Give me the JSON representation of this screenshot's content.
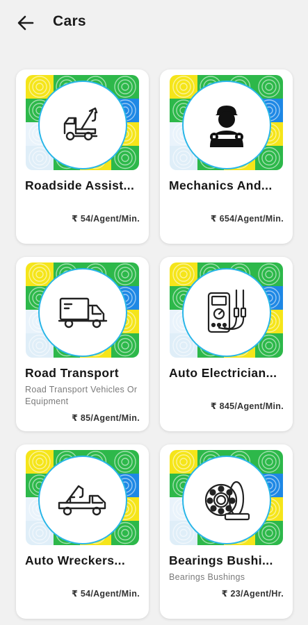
{
  "header": {
    "title": "Cars",
    "back_icon": "arrow-left-icon"
  },
  "colors": {
    "accent_circle": "#29b6e8",
    "pattern_green": "#2db84a",
    "pattern_yellow": "#f5e51a",
    "pattern_blue": "#1e88e5"
  },
  "cards": [
    {
      "name": "Roadside Assist...",
      "description": "",
      "price": "₹ 54/Agent/Min.",
      "icon": "tow-truck-icon"
    },
    {
      "name": "Mechanics And...",
      "description": "",
      "price": "₹ 654/Agent/Min.",
      "icon": "mechanic-icon"
    },
    {
      "name": "Road Transport",
      "description": "Road Transport Vehicles Or Equipment",
      "price": "₹ 85/Agent/Min.",
      "icon": "delivery-truck-icon"
    },
    {
      "name": "Auto Electrician...",
      "description": "",
      "price": "₹ 845/Agent/Min.",
      "icon": "multimeter-icon"
    },
    {
      "name": "Auto Wreckers...",
      "description": "",
      "price": "₹ 54/Agent/Min.",
      "icon": "wrecker-truck-icon"
    },
    {
      "name": "Bearings  Bushi...",
      "description": "Bearings  Bushings",
      "price": "₹ 23/Agent/Hr.",
      "icon": "bearing-icon"
    }
  ]
}
